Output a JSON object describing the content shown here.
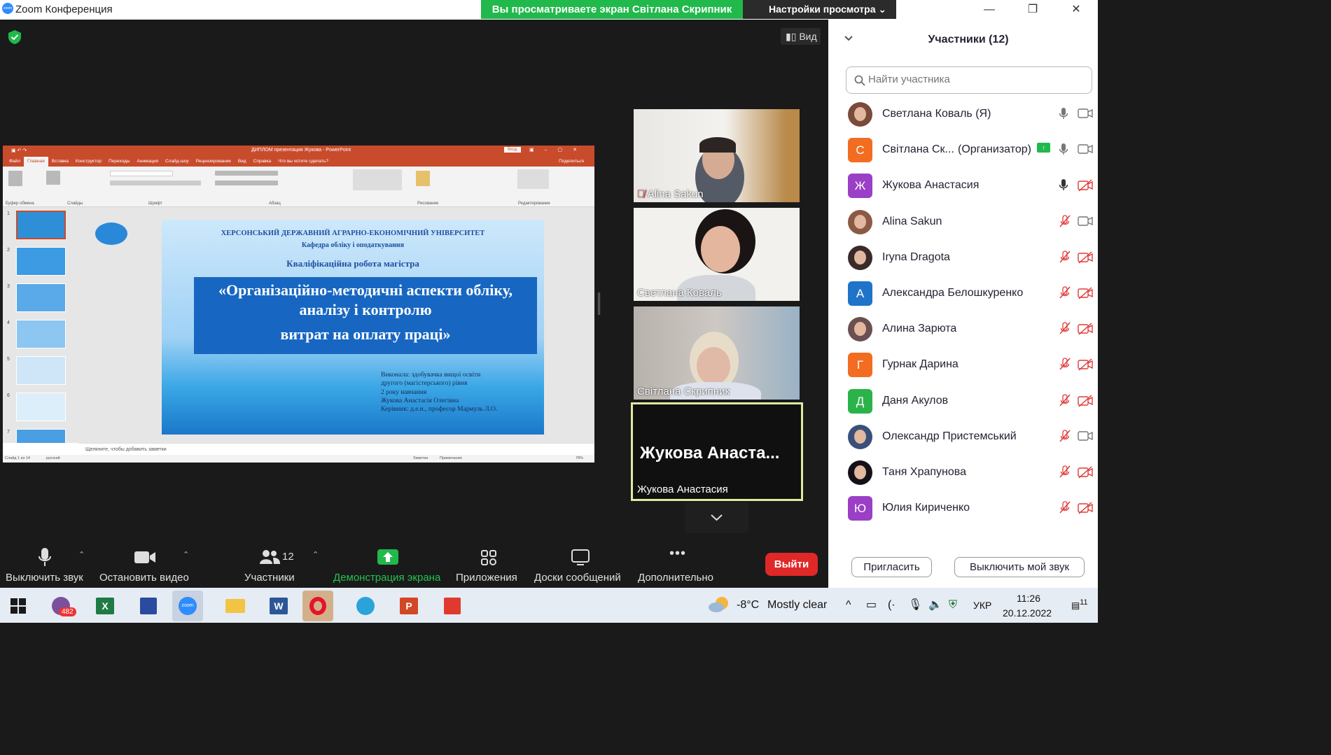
{
  "window": {
    "title": "Zoom Конференция",
    "logo": "zoom"
  },
  "banner": {
    "viewing_text": "Вы просматриваете экран Світлана Скрипник",
    "view_settings": "Настройки просмотра"
  },
  "meeting": {
    "view_label": "Вид"
  },
  "ppt": {
    "window_title": "ДИПЛОМ презентация Жукова - PowerPoint",
    "login": "Вход",
    "tabs": [
      "Файл",
      "Главная",
      "Вставка",
      "Конструктор",
      "Переходы",
      "Анимация",
      "Слайд-шоу",
      "Рецензирование",
      "Вид",
      "Справка",
      "Что вы хотите сделать?"
    ],
    "share": "Поделиться",
    "groups": [
      "Буфер обмена",
      "Слайды",
      "Шрифт",
      "Абзац",
      "Рисование",
      "Редактирование"
    ],
    "notes_placeholder": "Щелкните, чтобы добавить заметки",
    "status_left": "Слайд 1 из 14",
    "status_lang": "русский",
    "status_notes": "Заметки",
    "status_comments": "Примечания",
    "zoom": "78%",
    "slide": {
      "line1": "ХЕРСОНСЬКИЙ ДЕРЖАВНИЙ АГРАРНО-ЕКОНОМІЧНИЙ УНІВЕРСИТЕТ",
      "line2": "Кафедра обліку і оподаткування",
      "line3": "Кваліфікаційна робота магістра",
      "title1": "«Організаційно-методичні аспекти обліку,",
      "title2": "аналізу і контролю",
      "title3": "витрат на оплату праці»",
      "a1": "Виконала: здобувачка вищої освіти",
      "a2": "другого (магістерського) рівня",
      "a3": "2 року навчання",
      "a4": "Жукова Анастасія Олегівна",
      "a5": "Керівник: д.е.н., професор Мармуль Л.О."
    },
    "slide_numbers": [
      "1",
      "2",
      "3",
      "4",
      "5",
      "6",
      "7"
    ]
  },
  "videos": [
    {
      "name": "Alina Sakun",
      "muted": true
    },
    {
      "name": "Светлана Коваль"
    },
    {
      "name": "Світлана Скрипник"
    },
    {
      "name": "Жукова Анастасия",
      "big": "Жукова Анаста..."
    }
  ],
  "toolbar": {
    "mute": "Выключить звук",
    "video": "Остановить видео",
    "participants": "Участники",
    "participants_count": "12",
    "share": "Демонстрация экрана",
    "apps": "Приложения",
    "whiteboards": "Доски сообщений",
    "more": "Дополнительно",
    "leave": "Выйти"
  },
  "panel": {
    "title": "Участники (12)",
    "search_placeholder": "Найти участника",
    "invite": "Пригласить",
    "mute_me": "Выключить мой звук",
    "participants": [
      {
        "name": "Светлана Коваль (Я)",
        "avatar": "photo",
        "color": "#7a4a3a",
        "mic": "on",
        "cam": "on"
      },
      {
        "name": "Світлана Ск...",
        "org": "(Организатор)",
        "avatar": "С",
        "color": "#f26d21",
        "mic": "on",
        "cam": "on"
      },
      {
        "name": "Жукова Анастасия",
        "avatar": "Ж",
        "color": "#9a3fc6",
        "mic": "dark",
        "cam": "off"
      },
      {
        "name": "Alina Sakun",
        "avatar": "photo",
        "color": "#8a5a45",
        "mic": "off",
        "cam": "on"
      },
      {
        "name": "Iryna Dragota",
        "avatar": "photo",
        "color": "#3a2a2a",
        "mic": "off",
        "cam": "off"
      },
      {
        "name": "Александра Белошкуренко",
        "avatar": "А",
        "color": "#1f73c8",
        "mic": "off",
        "cam": "off"
      },
      {
        "name": "Алина Зарюта",
        "avatar": "photo",
        "color": "#6a5050",
        "mic": "off",
        "cam": "off"
      },
      {
        "name": "Гурнак Дарина",
        "avatar": "Г",
        "color": "#f26d21",
        "mic": "off",
        "cam": "off"
      },
      {
        "name": "Даня Акулов",
        "avatar": "Д",
        "color": "#2bb34a",
        "mic": "off",
        "cam": "off"
      },
      {
        "name": "Олександр Пристемський",
        "avatar": "photo",
        "color": "#3a4f7a",
        "mic": "off",
        "cam": "on"
      },
      {
        "name": "Таня Храпунова",
        "avatar": "photo",
        "color": "#141218",
        "mic": "off",
        "cam": "off"
      },
      {
        "name": "Юлия Кириченко",
        "avatar": "Ю",
        "color": "#9a3fc6",
        "mic": "off",
        "cam": "off"
      }
    ]
  },
  "taskbar": {
    "viber_badge": "482",
    "weather_temp": "-8°C",
    "weather_text": "Mostly clear",
    "lang": "УКР",
    "time": "11:26",
    "date": "20.12.2022",
    "notif": "11"
  }
}
